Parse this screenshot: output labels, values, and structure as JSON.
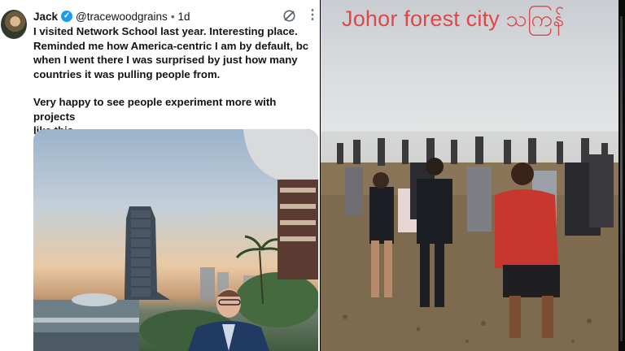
{
  "tweet": {
    "author_name": "Jack",
    "verified_mark": "✓",
    "handle": "@tracewoodgrains",
    "separator": "•",
    "time": "1d",
    "paragraphs": [
      "I visited Network School last year. Interesting place.\nReminded me how America-centric I am by default, bc\nwhen I went there I was surprised by just how many\ncountries it was pulling people from.",
      "Very happy to see people experiment more with projects\nlike this."
    ],
    "icons": {
      "avatar": "avatar-photo",
      "grok": "grok-icon",
      "more": "more-icon"
    },
    "colors": {
      "text": "#0f1419",
      "secondary": "#536471",
      "verified": "#1d9bf0"
    }
  },
  "video": {
    "caption": "Johor forest city သကြန်",
    "caption_color": "#e24646"
  }
}
